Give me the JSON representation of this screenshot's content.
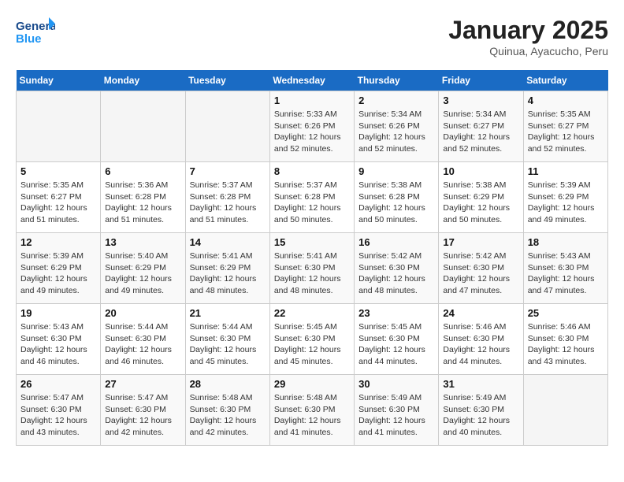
{
  "header": {
    "logo_line1": "General",
    "logo_line2": "Blue",
    "month": "January 2025",
    "location": "Quinua, Ayacucho, Peru"
  },
  "days_of_week": [
    "Sunday",
    "Monday",
    "Tuesday",
    "Wednesday",
    "Thursday",
    "Friday",
    "Saturday"
  ],
  "weeks": [
    [
      {
        "day": "",
        "sunrise": "",
        "sunset": "",
        "daylight": "",
        "empty": true
      },
      {
        "day": "",
        "sunrise": "",
        "sunset": "",
        "daylight": "",
        "empty": true
      },
      {
        "day": "",
        "sunrise": "",
        "sunset": "",
        "daylight": "",
        "empty": true
      },
      {
        "day": "1",
        "sunrise": "Sunrise: 5:33 AM",
        "sunset": "Sunset: 6:26 PM",
        "daylight": "Daylight: 12 hours and 52 minutes.",
        "empty": false
      },
      {
        "day": "2",
        "sunrise": "Sunrise: 5:34 AM",
        "sunset": "Sunset: 6:26 PM",
        "daylight": "Daylight: 12 hours and 52 minutes.",
        "empty": false
      },
      {
        "day": "3",
        "sunrise": "Sunrise: 5:34 AM",
        "sunset": "Sunset: 6:27 PM",
        "daylight": "Daylight: 12 hours and 52 minutes.",
        "empty": false
      },
      {
        "day": "4",
        "sunrise": "Sunrise: 5:35 AM",
        "sunset": "Sunset: 6:27 PM",
        "daylight": "Daylight: 12 hours and 52 minutes.",
        "empty": false
      }
    ],
    [
      {
        "day": "5",
        "sunrise": "Sunrise: 5:35 AM",
        "sunset": "Sunset: 6:27 PM",
        "daylight": "Daylight: 12 hours and 51 minutes.",
        "empty": false
      },
      {
        "day": "6",
        "sunrise": "Sunrise: 5:36 AM",
        "sunset": "Sunset: 6:28 PM",
        "daylight": "Daylight: 12 hours and 51 minutes.",
        "empty": false
      },
      {
        "day": "7",
        "sunrise": "Sunrise: 5:37 AM",
        "sunset": "Sunset: 6:28 PM",
        "daylight": "Daylight: 12 hours and 51 minutes.",
        "empty": false
      },
      {
        "day": "8",
        "sunrise": "Sunrise: 5:37 AM",
        "sunset": "Sunset: 6:28 PM",
        "daylight": "Daylight: 12 hours and 50 minutes.",
        "empty": false
      },
      {
        "day": "9",
        "sunrise": "Sunrise: 5:38 AM",
        "sunset": "Sunset: 6:28 PM",
        "daylight": "Daylight: 12 hours and 50 minutes.",
        "empty": false
      },
      {
        "day": "10",
        "sunrise": "Sunrise: 5:38 AM",
        "sunset": "Sunset: 6:29 PM",
        "daylight": "Daylight: 12 hours and 50 minutes.",
        "empty": false
      },
      {
        "day": "11",
        "sunrise": "Sunrise: 5:39 AM",
        "sunset": "Sunset: 6:29 PM",
        "daylight": "Daylight: 12 hours and 49 minutes.",
        "empty": false
      }
    ],
    [
      {
        "day": "12",
        "sunrise": "Sunrise: 5:39 AM",
        "sunset": "Sunset: 6:29 PM",
        "daylight": "Daylight: 12 hours and 49 minutes.",
        "empty": false
      },
      {
        "day": "13",
        "sunrise": "Sunrise: 5:40 AM",
        "sunset": "Sunset: 6:29 PM",
        "daylight": "Daylight: 12 hours and 49 minutes.",
        "empty": false
      },
      {
        "day": "14",
        "sunrise": "Sunrise: 5:41 AM",
        "sunset": "Sunset: 6:29 PM",
        "daylight": "Daylight: 12 hours and 48 minutes.",
        "empty": false
      },
      {
        "day": "15",
        "sunrise": "Sunrise: 5:41 AM",
        "sunset": "Sunset: 6:30 PM",
        "daylight": "Daylight: 12 hours and 48 minutes.",
        "empty": false
      },
      {
        "day": "16",
        "sunrise": "Sunrise: 5:42 AM",
        "sunset": "Sunset: 6:30 PM",
        "daylight": "Daylight: 12 hours and 48 minutes.",
        "empty": false
      },
      {
        "day": "17",
        "sunrise": "Sunrise: 5:42 AM",
        "sunset": "Sunset: 6:30 PM",
        "daylight": "Daylight: 12 hours and 47 minutes.",
        "empty": false
      },
      {
        "day": "18",
        "sunrise": "Sunrise: 5:43 AM",
        "sunset": "Sunset: 6:30 PM",
        "daylight": "Daylight: 12 hours and 47 minutes.",
        "empty": false
      }
    ],
    [
      {
        "day": "19",
        "sunrise": "Sunrise: 5:43 AM",
        "sunset": "Sunset: 6:30 PM",
        "daylight": "Daylight: 12 hours and 46 minutes.",
        "empty": false
      },
      {
        "day": "20",
        "sunrise": "Sunrise: 5:44 AM",
        "sunset": "Sunset: 6:30 PM",
        "daylight": "Daylight: 12 hours and 46 minutes.",
        "empty": false
      },
      {
        "day": "21",
        "sunrise": "Sunrise: 5:44 AM",
        "sunset": "Sunset: 6:30 PM",
        "daylight": "Daylight: 12 hours and 45 minutes.",
        "empty": false
      },
      {
        "day": "22",
        "sunrise": "Sunrise: 5:45 AM",
        "sunset": "Sunset: 6:30 PM",
        "daylight": "Daylight: 12 hours and 45 minutes.",
        "empty": false
      },
      {
        "day": "23",
        "sunrise": "Sunrise: 5:45 AM",
        "sunset": "Sunset: 6:30 PM",
        "daylight": "Daylight: 12 hours and 44 minutes.",
        "empty": false
      },
      {
        "day": "24",
        "sunrise": "Sunrise: 5:46 AM",
        "sunset": "Sunset: 6:30 PM",
        "daylight": "Daylight: 12 hours and 44 minutes.",
        "empty": false
      },
      {
        "day": "25",
        "sunrise": "Sunrise: 5:46 AM",
        "sunset": "Sunset: 6:30 PM",
        "daylight": "Daylight: 12 hours and 43 minutes.",
        "empty": false
      }
    ],
    [
      {
        "day": "26",
        "sunrise": "Sunrise: 5:47 AM",
        "sunset": "Sunset: 6:30 PM",
        "daylight": "Daylight: 12 hours and 43 minutes.",
        "empty": false
      },
      {
        "day": "27",
        "sunrise": "Sunrise: 5:47 AM",
        "sunset": "Sunset: 6:30 PM",
        "daylight": "Daylight: 12 hours and 42 minutes.",
        "empty": false
      },
      {
        "day": "28",
        "sunrise": "Sunrise: 5:48 AM",
        "sunset": "Sunset: 6:30 PM",
        "daylight": "Daylight: 12 hours and 42 minutes.",
        "empty": false
      },
      {
        "day": "29",
        "sunrise": "Sunrise: 5:48 AM",
        "sunset": "Sunset: 6:30 PM",
        "daylight": "Daylight: 12 hours and 41 minutes.",
        "empty": false
      },
      {
        "day": "30",
        "sunrise": "Sunrise: 5:49 AM",
        "sunset": "Sunset: 6:30 PM",
        "daylight": "Daylight: 12 hours and 41 minutes.",
        "empty": false
      },
      {
        "day": "31",
        "sunrise": "Sunrise: 5:49 AM",
        "sunset": "Sunset: 6:30 PM",
        "daylight": "Daylight: 12 hours and 40 minutes.",
        "empty": false
      },
      {
        "day": "",
        "sunrise": "",
        "sunset": "",
        "daylight": "",
        "empty": true
      }
    ]
  ]
}
